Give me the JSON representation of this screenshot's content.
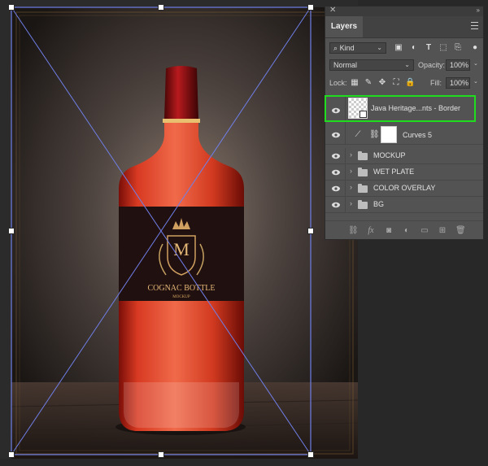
{
  "canvas": {
    "label_title": "COGNAC BOTTLE",
    "label_subtitle": "MOCKUP",
    "label_monogram": "M"
  },
  "layers_panel": {
    "close_icon": "close-icon",
    "collapse_icon": "double-chevron-icon",
    "tab_label": "Layers",
    "menu_icon": "hamburger-menu-icon",
    "filter": {
      "label": "Kind",
      "icon": "search-icon"
    },
    "filter_icons": [
      "image-filter-icon",
      "adjustment-filter-icon",
      "type-filter-icon",
      "shape-filter-icon",
      "smart-object-filter-icon",
      "filter-toggle-icon"
    ],
    "blend_mode": "Normal",
    "opacity": {
      "label": "Opacity:",
      "value": "100%"
    },
    "lock": {
      "label": "Lock:",
      "icons": [
        "lock-transparent-icon",
        "lock-image-icon",
        "lock-position-icon",
        "artboard-icon",
        "lock-all-icon"
      ]
    },
    "fill": {
      "label": "Fill:",
      "value": "100%"
    },
    "layers": [
      {
        "name": "Java Heritage...nts - Border",
        "type": "smart-object",
        "selected": true
      },
      {
        "name": "Curves 5",
        "type": "adjustment"
      },
      {
        "name": "MOCKUP",
        "type": "group"
      },
      {
        "name": "WET PLATE",
        "type": "group"
      },
      {
        "name": "COLOR OVERLAY",
        "type": "group"
      },
      {
        "name": "BG",
        "type": "group"
      }
    ],
    "footer_icons": [
      "link-layers-icon",
      "fx-icon",
      "mask-icon",
      "adjustment-layer-icon",
      "new-group-icon",
      "new-layer-icon",
      "trash-icon"
    ],
    "selection_color": "#1fdc1f"
  }
}
